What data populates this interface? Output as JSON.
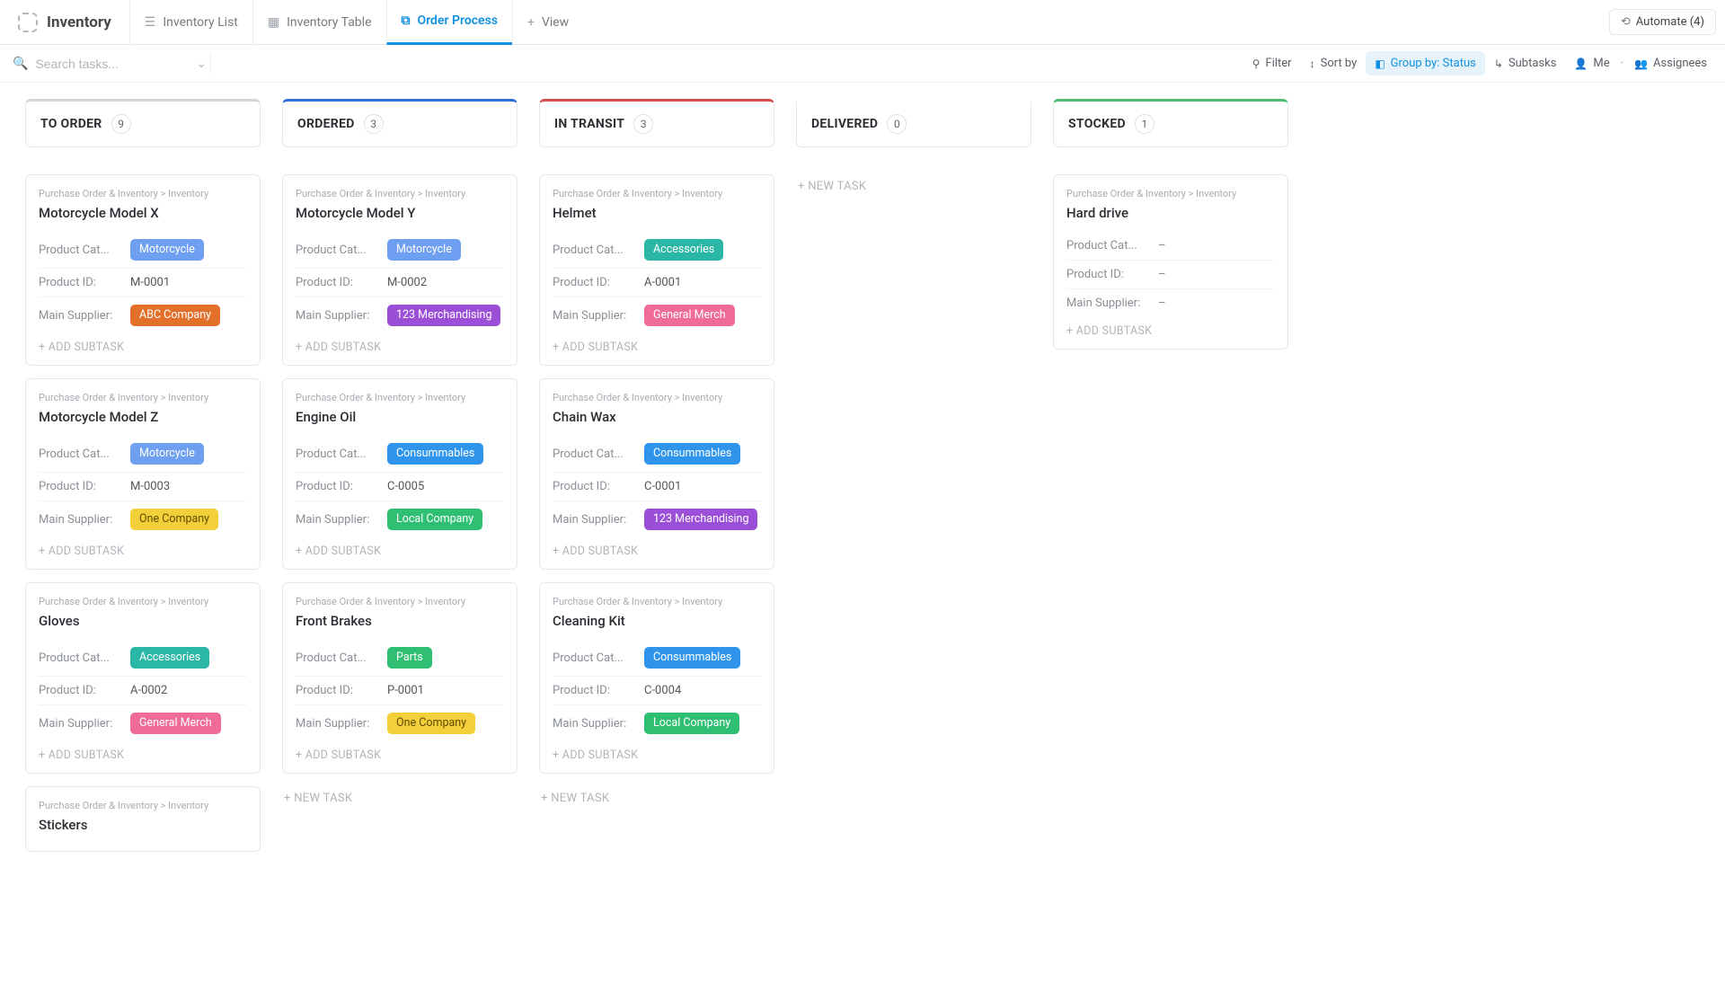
{
  "header": {
    "title": "Inventory",
    "tabs": [
      {
        "label": "Inventory List",
        "icon": "☰"
      },
      {
        "label": "Inventory Table",
        "icon": "▦"
      },
      {
        "label": "Order Process",
        "icon": "⧉",
        "active": true
      },
      {
        "label": "View",
        "icon": "+",
        "addview": true
      }
    ],
    "automate_label": "Automate (4)"
  },
  "toolbar": {
    "search_placeholder": "Search tasks...",
    "filter": "Filter",
    "sortby": "Sort by",
    "groupby": "Group by: Status",
    "subtasks": "Subtasks",
    "me": "Me",
    "assignees": "Assignees"
  },
  "labels": {
    "breadcrumb": "Purchase Order & Inventory  >  Inventory",
    "product_cat": "Product Cat...",
    "product_id": "Product ID:",
    "main_supplier": "Main Supplier:",
    "add_subtask": "+ ADD SUBTASK",
    "new_task": "+ NEW TASK",
    "dash": "–"
  },
  "tag_classes": {
    "Motorcycle": "tag-motorcycle",
    "Accessories": "tag-accessories",
    "Consummables": "tag-consummables",
    "Parts": "tag-parts",
    "ABC Company": "tag-abc",
    "123 Merchandising": "tag-123m",
    "General Merch": "tag-genmerch",
    "One Company": "tag-onecompany",
    "Local Company": "tag-localcompany"
  },
  "columns": [
    {
      "title": "TO ORDER",
      "count": 9,
      "top": "top-grey",
      "show_new_task": false,
      "cards": [
        {
          "title": "Motorcycle Model X",
          "category": "Motorcycle",
          "product_id": "M-0001",
          "supplier": "ABC Company"
        },
        {
          "title": "Motorcycle Model Z",
          "category": "Motorcycle",
          "product_id": "M-0003",
          "supplier": "One Company"
        },
        {
          "title": "Gloves",
          "category": "Accessories",
          "product_id": "A-0002",
          "supplier": "General Merch"
        },
        {
          "title": "Stickers",
          "partial": true
        }
      ]
    },
    {
      "title": "ORDERED",
      "count": 3,
      "top": "top-blue",
      "show_new_task": true,
      "cards": [
        {
          "title": "Motorcycle Model Y",
          "category": "Motorcycle",
          "product_id": "M-0002",
          "supplier": "123 Merchandising"
        },
        {
          "title": "Engine Oil",
          "category": "Consummables",
          "product_id": "C-0005",
          "supplier": "Local Company"
        },
        {
          "title": "Front Brakes",
          "category": "Parts",
          "product_id": "P-0001",
          "supplier": "One Company"
        }
      ]
    },
    {
      "title": "IN TRANSIT",
      "count": 3,
      "top": "top-red",
      "show_new_task": true,
      "cards": [
        {
          "title": "Helmet",
          "category": "Accessories",
          "product_id": "A-0001",
          "supplier": "General Merch"
        },
        {
          "title": "Chain Wax",
          "category": "Consummables",
          "product_id": "C-0001",
          "supplier": "123 Merchandising"
        },
        {
          "title": "Cleaning Kit",
          "category": "Consummables",
          "product_id": "C-0004",
          "supplier": "Local Company"
        }
      ]
    },
    {
      "title": "DELIVERED",
      "count": 0,
      "top": "top-none",
      "show_new_task": true,
      "cards": []
    },
    {
      "title": "STOCKED",
      "count": 1,
      "top": "top-green",
      "show_new_task": false,
      "cards": [
        {
          "title": "Hard drive",
          "category": null,
          "product_id": null,
          "supplier": null
        }
      ]
    }
  ]
}
